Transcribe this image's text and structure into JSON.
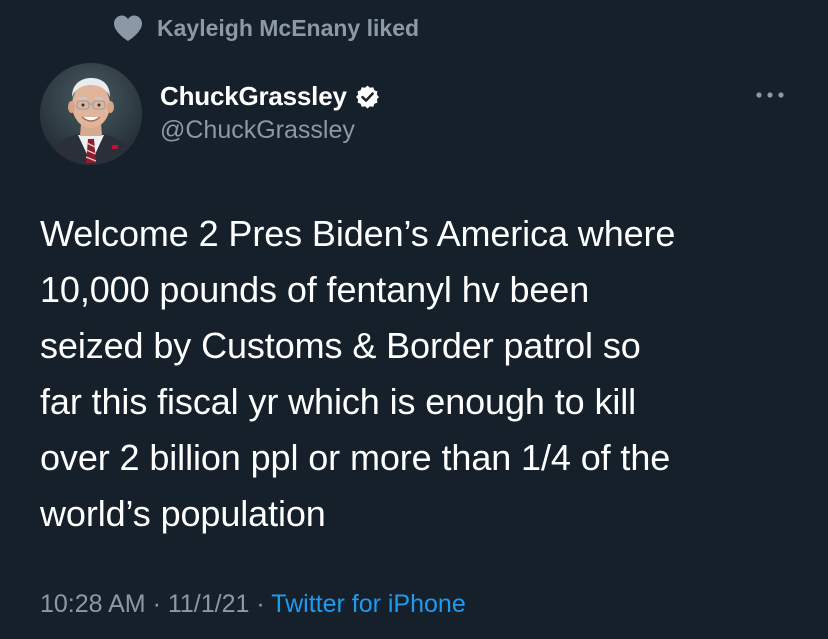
{
  "social_context": {
    "icon": "heart-icon",
    "text": "Kayleigh McEnany liked"
  },
  "tweet": {
    "author": {
      "display_name": "ChuckGrassley",
      "handle": "@ChuckGrassley",
      "verified": true
    },
    "more_icon": "more-dots-icon",
    "text_lines": [
      "Welcome 2 Pres Biden’s America where",
      "10,000 pounds of fentanyl hv been",
      "seized by Customs & Border patrol so",
      "far this fiscal yr which is enough to kill",
      "over 2 billion ppl or more than 1/4 of the",
      "world’s population"
    ],
    "time": "10:28 AM",
    "separator": " · ",
    "date": "11/1/21",
    "source": "Twitter for iPhone"
  },
  "colors": {
    "background": "#15202b",
    "primary_text": "#ffffff",
    "secondary_text": "#8b98a5",
    "link": "#1d9bf0"
  }
}
